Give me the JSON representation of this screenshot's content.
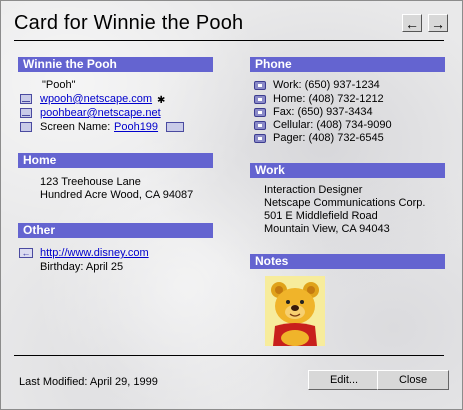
{
  "header": {
    "title": "Card for Winnie the Pooh",
    "back_arrow": "←",
    "forward_arrow": "→"
  },
  "contact": {
    "section": "Winnie the Pooh",
    "nickname": "\"Pooh\"",
    "emails": [
      "wpooh@netscape.com",
      "poohbear@netscape.net"
    ],
    "primary_marker": "✱",
    "screen_name_label": "Screen Name:",
    "screen_name": "Pooh199"
  },
  "home": {
    "section": "Home",
    "address": [
      "123 Treehouse Lane",
      "Hundred Acre Wood, CA 94087"
    ]
  },
  "other": {
    "section": "Other",
    "url": "http://www.disney.com",
    "birthday": "Birthday:  April 25"
  },
  "phone": {
    "section": "Phone",
    "items": [
      "Work:  (650) 937-1234",
      "Home:  (408) 732-1212",
      "Fax:  (650) 937-3434",
      "Cellular:  (408) 734-9090",
      "Pager:  (408) 732-6545"
    ]
  },
  "work": {
    "section": "Work",
    "lines": [
      "Interaction Designer",
      "Netscape Communications Corp.",
      "501 E Middlefield Road",
      "Mountain View, CA 94043"
    ]
  },
  "notes": {
    "section": "Notes",
    "image": "winnie-the-pooh-picture"
  },
  "footer": {
    "last_modified": "Last Modified: April 29, 1999",
    "edit_label": "Edit...",
    "close_label": "Close"
  },
  "colors": {
    "section_bar": "#6464d0",
    "link": "#0000cc"
  }
}
